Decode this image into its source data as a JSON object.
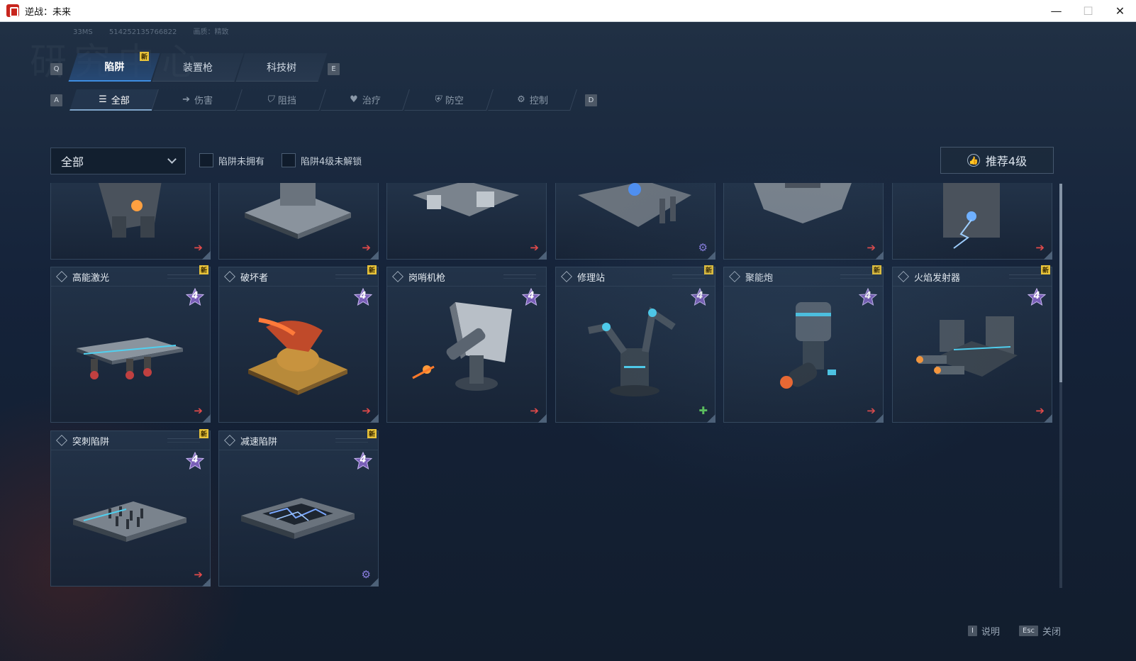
{
  "window": {
    "title": "逆战：未来",
    "minimize": "—",
    "maximize": "☐",
    "close": "✕"
  },
  "meta": {
    "ping": "33MS",
    "uid": "514252135766822",
    "quality": "画质：精致"
  },
  "bg_title": "研究中心",
  "top_tabs": {
    "key_left": "Q",
    "key_right": "E",
    "new_label": "新",
    "items": [
      {
        "label": "陷阱",
        "active": true,
        "is_new": true
      },
      {
        "label": "装置枪",
        "active": false
      },
      {
        "label": "科技树",
        "active": false
      }
    ]
  },
  "sub_tabs": {
    "key_left": "A",
    "key_right": "D",
    "items": [
      {
        "label": "全部",
        "icon": "list-icon",
        "glyph": "☰",
        "active": true
      },
      {
        "label": "伤害",
        "icon": "arrow-icon",
        "glyph": "➔"
      },
      {
        "label": "阻挡",
        "icon": "shield-icon",
        "glyph": "⛉"
      },
      {
        "label": "治疗",
        "icon": "heart-plus-icon",
        "glyph": "♥"
      },
      {
        "label": "防空",
        "icon": "anti-air-icon",
        "glyph": "⛨"
      },
      {
        "label": "控制",
        "icon": "gear-icon",
        "glyph": "⚙"
      }
    ]
  },
  "filters": {
    "dropdown_value": "全部",
    "checkbox_not_owned": "陷阱未拥有",
    "checkbox_lv4_locked": "陷阱4级未解锁",
    "recommend_button": "推荐4级"
  },
  "colors": {
    "accent_blue": "#3e8de0",
    "new_badge": "#e8c33a",
    "damage_arrow": "#e04a4a",
    "control_gear": "#8a7ee0",
    "heal_plus": "#5cc45c",
    "level_star": "#7a5fb8"
  },
  "cards_partial": [
    {
      "type_icon": "arrow-red"
    },
    {
      "type_icon": "arrow-red"
    },
    {
      "type_icon": "arrow-red"
    },
    {
      "type_icon": "gear-purple"
    },
    {
      "type_icon": "arrow-red"
    },
    {
      "type_icon": "arrow-red"
    }
  ],
  "cards": [
    {
      "name": "高能激光",
      "level": "4",
      "is_new": true,
      "type_icon": "arrow-red"
    },
    {
      "name": "破坏者",
      "level": "4",
      "is_new": true,
      "type_icon": "arrow-red"
    },
    {
      "name": "岗哨机枪",
      "level": "4",
      "is_new": false,
      "type_icon": "arrow-red"
    },
    {
      "name": "修理站",
      "level": "4",
      "is_new": true,
      "type_icon": "heal-green"
    },
    {
      "name": "聚能炮",
      "level": "4",
      "is_new": true,
      "type_icon": "arrow-red"
    },
    {
      "name": "火焰发射器",
      "level": "4",
      "is_new": true,
      "type_icon": "arrow-red"
    },
    {
      "name": "突刺陷阱",
      "level": "4",
      "is_new": true,
      "type_icon": "arrow-red"
    },
    {
      "name": "减速陷阱",
      "level": "4",
      "is_new": true,
      "type_icon": "gear-purple"
    }
  ],
  "bottom": {
    "help_key": "I",
    "help_label": "说明",
    "close_key": "Esc",
    "close_label": "关闭"
  }
}
